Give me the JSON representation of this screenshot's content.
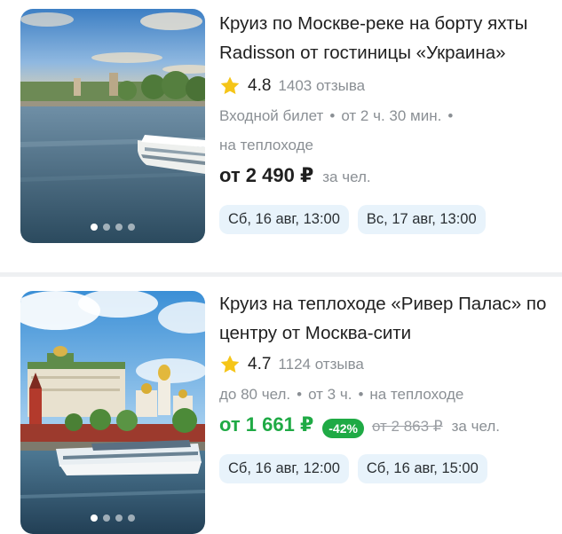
{
  "listings": [
    {
      "title": "Круиз по Москве-реке на борту яхты Radisson от гостиницы «Украина»",
      "rating": "4.8",
      "reviews": "1403 отзыва",
      "meta_line1": [
        "Входной билет",
        "от 2 ч. 30 мин."
      ],
      "meta_line2": "на теплоходе",
      "price": "от 2 490 ₽",
      "per": "за чел.",
      "dates": [
        "Сб, 16 авг, 13:00",
        "Вс, 17 авг, 13:00"
      ]
    },
    {
      "title": "Круиз на теплоходе «Ривер Палас» по центру от Москва-сити",
      "rating": "4.7",
      "reviews": "1124 отзыва",
      "meta_line1": [
        "до 80 чел.",
        "от 3 ч.",
        "на теплоходе"
      ],
      "price": "от 1 661 ₽",
      "discount": "-42%",
      "old_price": "от 2 863 ₽",
      "per": "за чел.",
      "dates": [
        "Сб, 16 авг, 12:00",
        "Сб, 16 авг, 15:00"
      ]
    }
  ],
  "bullet": "•",
  "colors": {
    "star": "#f5c518",
    "sale": "#1faa45",
    "chip_bg": "#e8f3fb",
    "muted": "#8a8f94"
  },
  "icons": {
    "rating": "star-icon"
  }
}
